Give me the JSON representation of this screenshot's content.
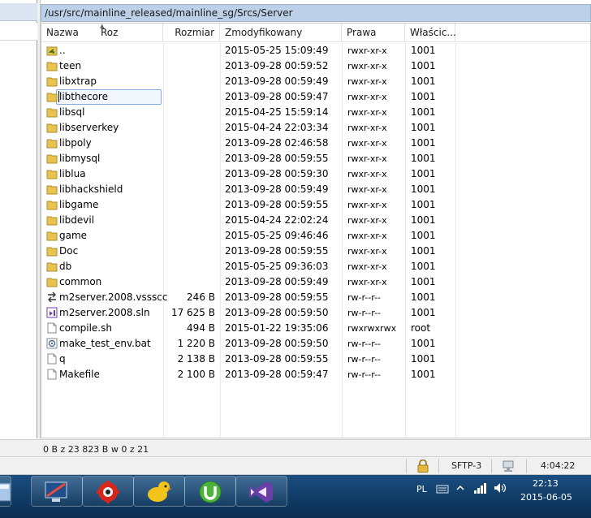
{
  "path": "/usr/src/mainline_released/mainline_sg/Srcs/Server",
  "columns": {
    "name": "Nazwa",
    "sort_hint": "Roz",
    "size": "Rozmiar",
    "modified": "Zmodyfikowany",
    "rights": "Prawa",
    "owner": "Właścic..."
  },
  "files": [
    {
      "name": "..",
      "size": "",
      "modified": "2015-05-25 15:09:49",
      "rights": "rwxr-xr-x",
      "owner": "1001",
      "icon": "parent-folder-icon"
    },
    {
      "name": "teen",
      "size": "",
      "modified": "2013-09-28 00:59:52",
      "rights": "rwxr-xr-x",
      "owner": "1001",
      "icon": "folder-icon"
    },
    {
      "name": "libxtrap",
      "size": "",
      "modified": "2013-09-28 00:59:49",
      "rights": "rwxr-xr-x",
      "owner": "1001",
      "icon": "folder-icon"
    },
    {
      "name": "libthecore",
      "size": "",
      "modified": "2013-09-28 00:59:47",
      "rights": "rwxr-xr-x",
      "owner": "1001",
      "icon": "folder-icon"
    },
    {
      "name": "libsql",
      "size": "",
      "modified": "2015-04-25 15:59:14",
      "rights": "rwxr-xr-x",
      "owner": "1001",
      "icon": "folder-icon"
    },
    {
      "name": "libserverkey",
      "size": "",
      "modified": "2015-04-24 22:03:34",
      "rights": "rwxr-xr-x",
      "owner": "1001",
      "icon": "folder-icon"
    },
    {
      "name": "libpoly",
      "size": "",
      "modified": "2013-09-28 02:46:58",
      "rights": "rwxr-xr-x",
      "owner": "1001",
      "icon": "folder-icon"
    },
    {
      "name": "libmysql",
      "size": "",
      "modified": "2013-09-28 00:59:55",
      "rights": "rwxr-xr-x",
      "owner": "1001",
      "icon": "folder-icon"
    },
    {
      "name": "liblua",
      "size": "",
      "modified": "2013-09-28 00:59:30",
      "rights": "rwxr-xr-x",
      "owner": "1001",
      "icon": "folder-icon"
    },
    {
      "name": "libhackshield",
      "size": "",
      "modified": "2013-09-28 00:59:49",
      "rights": "rwxr-xr-x",
      "owner": "1001",
      "icon": "folder-icon"
    },
    {
      "name": "libgame",
      "size": "",
      "modified": "2013-09-28 00:59:55",
      "rights": "rwxr-xr-x",
      "owner": "1001",
      "icon": "folder-icon"
    },
    {
      "name": "libdevil",
      "size": "",
      "modified": "2015-04-24 22:02:24",
      "rights": "rwxr-xr-x",
      "owner": "1001",
      "icon": "folder-icon"
    },
    {
      "name": "game",
      "size": "",
      "modified": "2015-05-25 09:46:46",
      "rights": "rwxr-xr-x",
      "owner": "1001",
      "icon": "folder-icon"
    },
    {
      "name": "Doc",
      "size": "",
      "modified": "2013-09-28 00:59:55",
      "rights": "rwxr-xr-x",
      "owner": "1001",
      "icon": "folder-icon"
    },
    {
      "name": "db",
      "size": "",
      "modified": "2015-05-25 09:36:03",
      "rights": "rwxr-xr-x",
      "owner": "1001",
      "icon": "folder-icon"
    },
    {
      "name": "common",
      "size": "",
      "modified": "2013-09-28 00:59:49",
      "rights": "rwxr-xr-x",
      "owner": "1001",
      "icon": "folder-icon"
    },
    {
      "name": "m2server.2008.vssscc",
      "size": "246 B",
      "modified": "2013-09-28 00:59:55",
      "rights": "rw-r--r--",
      "owner": "1001",
      "icon": "sourcecontrol-file-icon"
    },
    {
      "name": "m2server.2008.sln",
      "size": "17 625 B",
      "modified": "2013-09-28 00:59:50",
      "rights": "rw-r--r--",
      "owner": "1001",
      "icon": "visual-studio-solution-icon"
    },
    {
      "name": "compile.sh",
      "size": "494 B",
      "modified": "2015-01-22 19:35:06",
      "rights": "rwxrwxrwx",
      "owner": "root",
      "icon": "blank-file-icon"
    },
    {
      "name": "make_test_env.bat",
      "size": "1 220 B",
      "modified": "2013-09-28 00:59:50",
      "rights": "rw-r--r--",
      "owner": "1001",
      "icon": "batch-file-icon"
    },
    {
      "name": "q",
      "size": "2 138 B",
      "modified": "2013-09-28 00:59:55",
      "rights": "rw-r--r--",
      "owner": "1001",
      "icon": "blank-file-icon"
    },
    {
      "name": "Makefile",
      "size": "2 100 B",
      "modified": "2013-09-28 00:59:47",
      "rights": "rw-r--r--",
      "owner": "1001",
      "icon": "blank-file-icon"
    }
  ],
  "status": {
    "selection": "0 B z 23 823 B w 0 z 21",
    "protocol": "SFTP-3",
    "elapsed": "4:04:22"
  },
  "taskbar": {
    "language": "PL",
    "time": "22:13",
    "date": "2015-06-05"
  },
  "colors": {
    "folder": "#e9c34f",
    "path_bar": "#bcd0e8",
    "taskbar": "#123f6b"
  }
}
